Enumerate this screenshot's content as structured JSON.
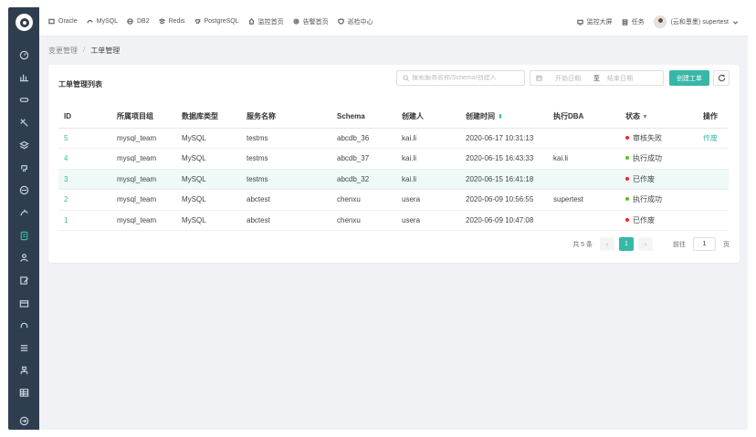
{
  "topnav": [
    {
      "label": "Oracle",
      "icon": "database-icon"
    },
    {
      "label": "MySQL",
      "icon": "dolphin-icon"
    },
    {
      "label": "DB2",
      "icon": "disk-icon"
    },
    {
      "label": "Redis",
      "icon": "layers-icon"
    },
    {
      "label": "PostgreSQL",
      "icon": "elephant-icon"
    },
    {
      "label": "监控首页",
      "icon": "home-icon"
    },
    {
      "label": "告警首页",
      "icon": "gear-icon"
    },
    {
      "label": "巡检中心",
      "icon": "shield-icon"
    }
  ],
  "header_right": {
    "monitor": "监控大屏",
    "tasks": "任务",
    "user": "(云和恩墨) supertest"
  },
  "breadcrumb": {
    "parent": "变更管理",
    "sep": "/",
    "current": "工单管理"
  },
  "card": {
    "title": "工单管理列表",
    "search_placeholder": "搜索服务名称/Schema/创建人",
    "date_start": "开始日期",
    "date_to": "至",
    "date_end": "结束日期",
    "create_label": "创建工单"
  },
  "table": {
    "columns": [
      "ID",
      "所属项目组",
      "数据库类型",
      "服务名称",
      "Schema",
      "创建时间",
      "执行DBA",
      "状态",
      "操作",
      "创建人"
    ],
    "rows": [
      {
        "id": "5",
        "group": "mysql_team",
        "dbtype": "MySQL",
        "service": "testms",
        "schema": "abcdb_36",
        "creator": "kai.li",
        "time": "2020-06-17 10:31:13",
        "dba": "",
        "status": "审核失败",
        "status_color": "#f5222d",
        "action": "作废"
      },
      {
        "id": "4",
        "group": "mysql_team",
        "dbtype": "MySQL",
        "service": "testms",
        "schema": "abcdb_37",
        "creator": "kai.li",
        "time": "2020-06-15 16:43:33",
        "dba": "kai.li",
        "status": "执行成功",
        "status_color": "#52c41a",
        "action": ""
      },
      {
        "id": "3",
        "group": "mysql_team",
        "dbtype": "MySQL",
        "service": "testms",
        "schema": "abcdb_32",
        "creator": "kai.li",
        "time": "2020-06-15 16:41:18",
        "dba": "",
        "status": "已作废",
        "status_color": "#f5222d",
        "action": ""
      },
      {
        "id": "2",
        "group": "mysql_team",
        "dbtype": "MySQL",
        "service": "abctest",
        "schema": "chenxu",
        "creator": "usera",
        "time": "2020-06-09 10:56:55",
        "dba": "supertest",
        "status": "执行成功",
        "status_color": "#52c41a",
        "action": ""
      },
      {
        "id": "1",
        "group": "mysql_team",
        "dbtype": "MySQL",
        "service": "abctest",
        "schema": "chenxu",
        "creator": "usera",
        "time": "2020-06-09 10:47:08",
        "dba": "",
        "status": "已作废",
        "status_color": "#f5222d",
        "action": ""
      }
    ]
  },
  "pagination": {
    "total": "共 5 条",
    "current": "1",
    "goto_label": "前往",
    "goto_value": "1",
    "page_suffix": "页"
  }
}
